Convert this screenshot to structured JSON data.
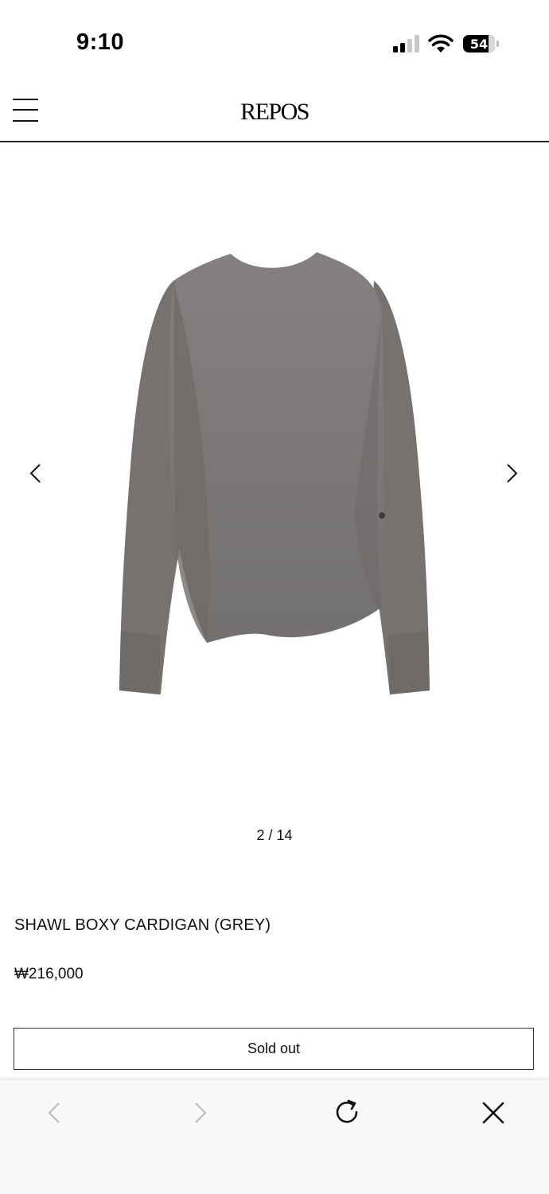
{
  "status_bar": {
    "time": "9:10",
    "battery": "54",
    "signal_icon": "cellular-signal-icon",
    "wifi_icon": "wifi-icon"
  },
  "header": {
    "logo": "REPOS",
    "menu_icon": "hamburger-menu-icon"
  },
  "gallery": {
    "current": "2",
    "total": "14",
    "counter": "2 / 14",
    "prev_icon": "chevron-left-icon",
    "next_icon": "chevron-right-icon",
    "image_color": "#7c7775"
  },
  "product": {
    "title": "SHAWL BOXY CARDIGAN (GREY)",
    "price": "₩216,000",
    "button_label": "Sold out"
  },
  "browser_toolbar": {
    "back_icon": "back-arrow-icon",
    "forward_icon": "forward-arrow-icon",
    "reload_icon": "reload-icon",
    "close_icon": "close-icon"
  }
}
